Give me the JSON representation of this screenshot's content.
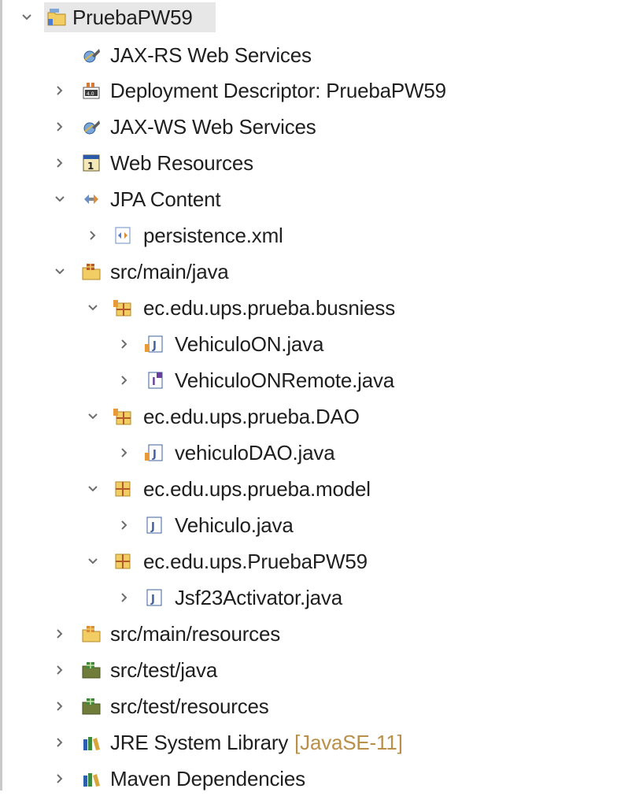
{
  "tree": [
    {
      "key": "project",
      "label": "PruebaPW59",
      "decoration": "",
      "icon": "project-folder-icon",
      "expander": "expanded",
      "selected": true
    },
    {
      "key": "jaxrs",
      "label": "JAX-RS Web Services",
      "decoration": "",
      "icon": "web-services-icon",
      "expander": "none"
    },
    {
      "key": "deployment",
      "label": "Deployment Descriptor: PruebaPW59",
      "decoration": "",
      "icon": "deployment-descriptor-icon",
      "expander": "collapsed"
    },
    {
      "key": "jaxws",
      "label": "JAX-WS Web Services",
      "decoration": "",
      "icon": "web-services-icon",
      "expander": "collapsed"
    },
    {
      "key": "webres",
      "label": "Web Resources",
      "decoration": "",
      "icon": "web-resources-icon",
      "expander": "collapsed"
    },
    {
      "key": "jpa",
      "label": "JPA Content",
      "decoration": "",
      "icon": "jpa-content-icon",
      "expander": "expanded"
    },
    {
      "key": "persistence",
      "label": "persistence.xml",
      "decoration": "",
      "icon": "xml-file-icon",
      "expander": "collapsed"
    },
    {
      "key": "srcmainjava",
      "label": "src/main/java",
      "decoration": "",
      "icon": "source-folder-icon",
      "expander": "expanded"
    },
    {
      "key": "pkg-busniess",
      "label": "ec.edu.ups.prueba.busniess",
      "decoration": "",
      "icon": "package-bean-icon",
      "expander": "expanded"
    },
    {
      "key": "vehiculoon",
      "label": "VehiculoON.java",
      "decoration": "",
      "icon": "java-bean-class-icon",
      "expander": "collapsed"
    },
    {
      "key": "vehiculoonremote",
      "label": "VehiculoONRemote.java",
      "decoration": "",
      "icon": "java-interface-icon",
      "expander": "collapsed"
    },
    {
      "key": "pkg-dao",
      "label": "ec.edu.ups.prueba.DAO",
      "decoration": "",
      "icon": "package-bean-icon",
      "expander": "expanded"
    },
    {
      "key": "vehiculodao",
      "label": "vehiculoDAO.java",
      "decoration": "",
      "icon": "java-bean-class-icon",
      "expander": "collapsed"
    },
    {
      "key": "pkg-model",
      "label": "ec.edu.ups.prueba.model",
      "decoration": "",
      "icon": "package-icon",
      "expander": "expanded"
    },
    {
      "key": "vehiculo",
      "label": "Vehiculo.java",
      "decoration": "",
      "icon": "java-class-icon",
      "expander": "collapsed"
    },
    {
      "key": "pkg-pruebapw59",
      "label": "ec.edu.ups.PruebaPW59",
      "decoration": "",
      "icon": "package-icon",
      "expander": "expanded"
    },
    {
      "key": "jsf23",
      "label": "Jsf23Activator.java",
      "decoration": "",
      "icon": "java-class-icon",
      "expander": "collapsed"
    },
    {
      "key": "srcmainres",
      "label": "src/main/resources",
      "decoration": "",
      "icon": "resource-folder-icon",
      "expander": "collapsed"
    },
    {
      "key": "srctestjava",
      "label": "src/test/java",
      "decoration": "",
      "icon": "test-source-folder-icon",
      "expander": "collapsed"
    },
    {
      "key": "srctestres",
      "label": "src/test/resources",
      "decoration": "",
      "icon": "test-source-folder-icon",
      "expander": "collapsed"
    },
    {
      "key": "jre",
      "label": "JRE System Library",
      "decoration": "[JavaSE-11]",
      "icon": "library-icon",
      "expander": "collapsed"
    },
    {
      "key": "maven",
      "label": "Maven Dependencies",
      "decoration": "",
      "icon": "library-icon",
      "expander": "collapsed"
    }
  ],
  "colors": {
    "text": "#1f1f1f",
    "decoration": "#b98f4a",
    "selection": "#e7e7e7",
    "expander": "#6e6e6e"
  }
}
